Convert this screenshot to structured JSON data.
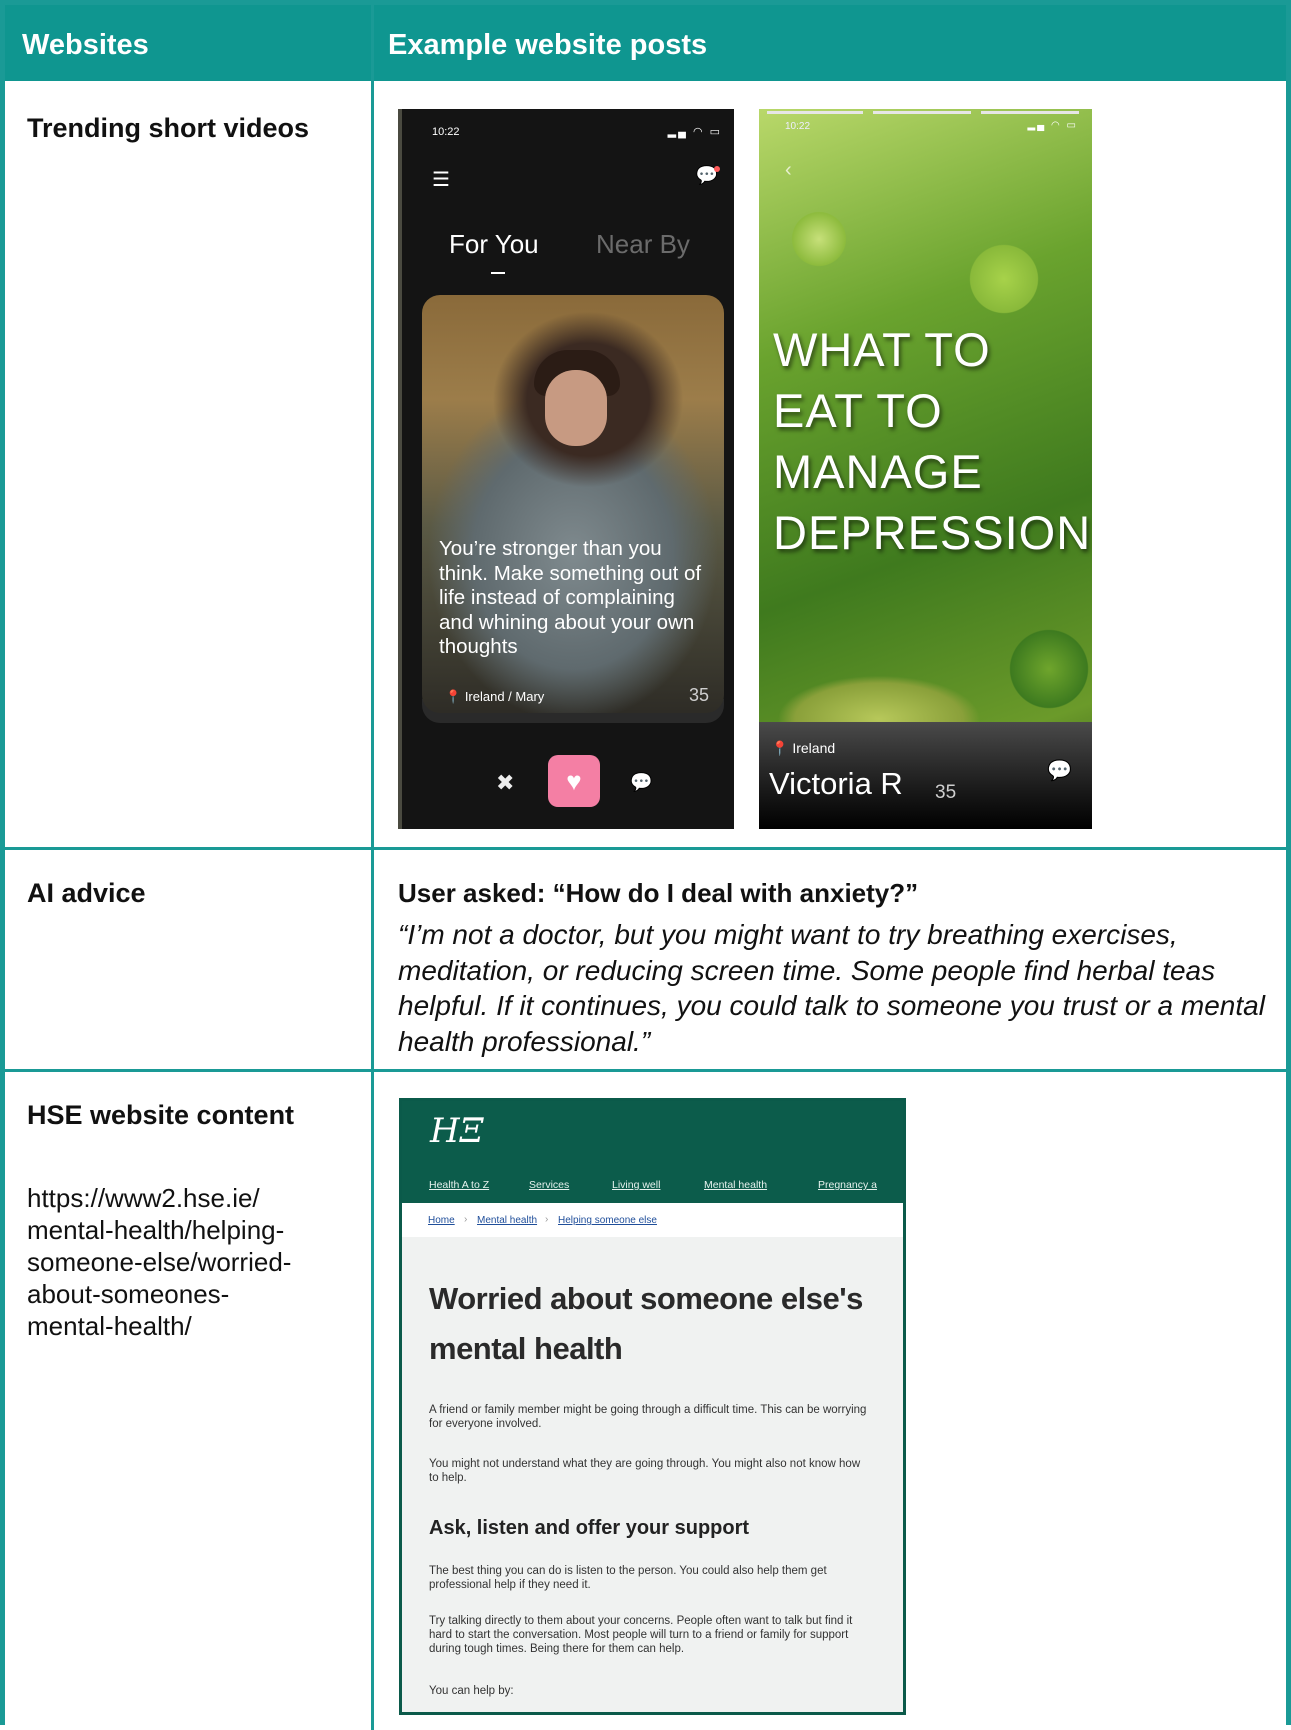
{
  "header": {
    "col1": "Websites",
    "col2": "Example website posts"
  },
  "rows": {
    "trending": {
      "label": "Trending short videos"
    },
    "ai": {
      "label": "AI advice",
      "question": "User asked: “How do I deal with anxiety?”",
      "answer": "“I’m not a doctor, but you might want to try breathing exercises, meditation, or reducing screen time. Some people find herbal teas helpful. If it continues, you could talk to someone you trust or a mental health professional.”"
    },
    "hse": {
      "label": "HSE website content",
      "url": "https://www2.hse.ie/\nmental-health/helping-\nsomeone-else/worried-\nabout-someones-\nmental-health/"
    }
  },
  "phone1": {
    "time": "10:22",
    "status_icons": "signal wifi battery",
    "tab_for_you": "For You",
    "tab_near_by": "Near By",
    "quote": "You’re stronger than you think. Make something out of life instead of complaining and whining about your own thoughts",
    "location": "Ireland / Mary",
    "count": "35",
    "icons": [
      "menu-icon",
      "chat-icon",
      "location-pin-icon",
      "close-icon",
      "heart-icon",
      "comment-icon"
    ]
  },
  "phone2": {
    "time": "10:22",
    "title": "WHAT TO EAT TO MANAGE DEPRESSION",
    "location": "Ireland",
    "name": "Victoria R",
    "count": "35",
    "icons": [
      "back-arrow-icon",
      "location-pin-icon",
      "comment-icon"
    ]
  },
  "hse_page": {
    "logo": "HSE",
    "nav": [
      "Health A to Z",
      "Services",
      "Living well",
      "Mental health",
      "Pregnancy a"
    ],
    "breadcrumb": [
      "Home",
      "Mental health",
      "Helping someone else"
    ],
    "title": "Worried about someone else's mental health",
    "p1": "A friend or family member might be going through a difficult time. This can be worrying for everyone involved.",
    "p2": "You might not understand what they are going through. You might also not know how to help.",
    "h2": "Ask, listen and offer your support",
    "p3": "The best thing you can do is listen to the person. You could also help them get professional help if they need it.",
    "p4": "Try talking directly to them about your concerns. People often want to talk but find it hard to start the conversation. Most people will turn to a friend or family for support during tough times. Being there for them can help.",
    "p5": "You can help by:"
  },
  "colors": {
    "teal": "#0f9690",
    "hse_green": "#0c5c4b",
    "heart_pink": "#f47fa4"
  }
}
